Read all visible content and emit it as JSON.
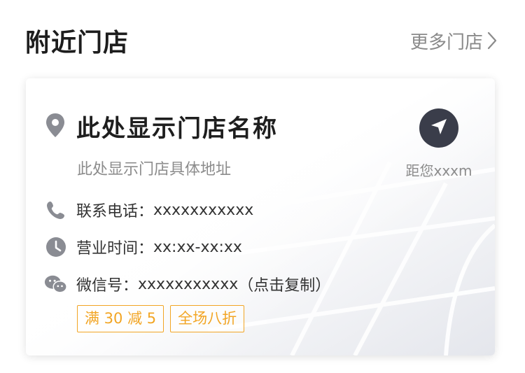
{
  "header": {
    "title": "附近门店",
    "more_label": "更多门店"
  },
  "store": {
    "name": "此处显示门店名称",
    "address": "此处显示门店具体地址",
    "distance": "距您xxxm",
    "phone_label": "联系电话：",
    "phone_value": "xxxxxxxxxxx",
    "hours_label": "营业时间：",
    "hours_value": "xx:xx-xx:xx",
    "wechat_label": "微信号：",
    "wechat_value": "xxxxxxxxxxx",
    "wechat_copy_hint": "（点击复制）",
    "tags": [
      "满 30 减 5",
      "全场八折"
    ]
  },
  "icons": {
    "location": "location-pin-icon",
    "navigate": "navigation-arrow-icon",
    "phone": "phone-icon",
    "clock": "clock-icon",
    "wechat": "wechat-icon",
    "chevron": "chevron-right-icon"
  },
  "colors": {
    "tag_accent": "#f2a524",
    "nav_button": "#3a3d4a",
    "icon_gray": "#8a8c93"
  }
}
